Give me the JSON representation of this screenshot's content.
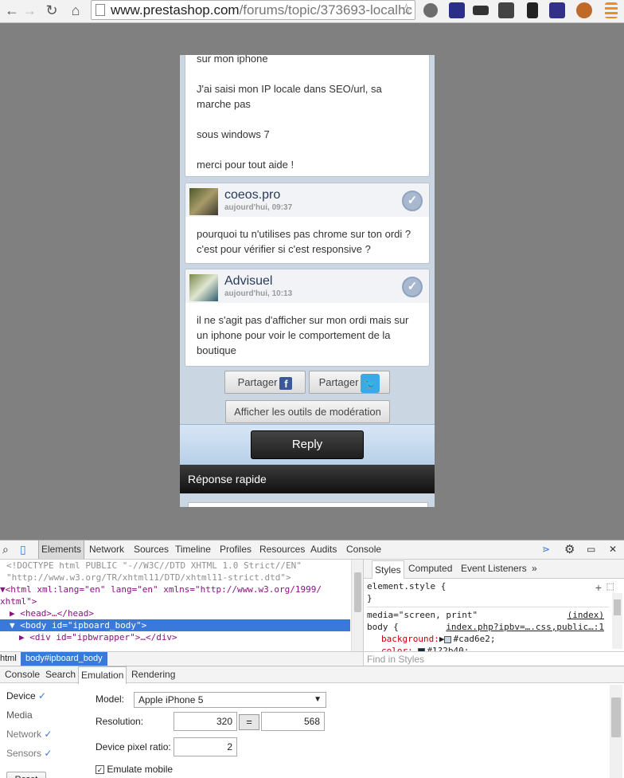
{
  "browser": {
    "url_host": "www.prestashop.com",
    "url_path": "/forums/topic/373693-localhc"
  },
  "page": {
    "first_post": {
      "lines": [
        "sur mon iphone",
        "J'ai saisi mon IP locale dans SEO/url, sa marche pas",
        "sous windows 7",
        "merci pour tout aide !"
      ]
    },
    "posts": [
      {
        "author": "coeos.pro",
        "date": "aujourd'hui, 09:37",
        "text": "pourquoi tu n'utilises pas chrome sur ton ordi ? c'est pour vérifier si c'est responsive ?"
      },
      {
        "author": "Advisuel",
        "date": "aujourd'hui, 10:13",
        "text": "il ne s'agit pas d'afficher sur mon ordi mais sur un iphone pour voir le comportement de la boutique"
      }
    ],
    "share_fb": "Partager",
    "share_tw": "Partager",
    "moderation": "Afficher les outils de modération",
    "reply": "Reply",
    "quick_reply": "Réponse rapide"
  },
  "devtools": {
    "tabs": [
      "Elements",
      "Network",
      "Sources",
      "Timeline",
      "Profiles",
      "Resources",
      "Audits",
      "Console"
    ],
    "code_lines": [
      "<!DOCTYPE html PUBLIC \"-//W3C//DTD XHTML 1.0 Strict//EN\"",
      "\"http://www.w3.org/TR/xhtml11/DTD/xhtml11-strict.dtd\">",
      "<html xml:lang=\"en\" lang=\"en\" xmlns=\"http://www.w3.org/1999/",
      "xhtml\">",
      "<head>…</head>",
      "<body id=\"ipboard_body\">",
      "<div id=\"ipbwrapper\">…</div>"
    ],
    "crumb_left": "html",
    "crumb_selected": "body#ipboard_body",
    "styles_tabs": [
      "Styles",
      "Computed",
      "Event Listeners",
      "»"
    ],
    "element_style": "element.style {",
    "close_brace": "}",
    "media": "media=\"screen, print\"",
    "media_link": "(index)",
    "body_rule": "body {",
    "body_link": "index.php?ipbv=….css,public…:1",
    "background_prop": "background:",
    "background_val": "#cad6e2;",
    "color_prop": "color:",
    "color_val": "#1?2b40;",
    "find_placeholder": "Find in Styles",
    "drawer_tabs": [
      "Console",
      "Search",
      "Emulation",
      "Rendering"
    ],
    "emu_side": [
      "Device",
      "Media",
      "Network",
      "Sensors"
    ],
    "model_label": "Model:",
    "model_value": "Apple iPhone 5",
    "resolution_label": "Resolution:",
    "res_width": "320",
    "res_height": "568",
    "swap_icon": "=",
    "dpr_label": "Device pixel ratio:",
    "dpr_value": "2",
    "emulate_mobile": "Emulate mobile",
    "reset": "Reset"
  }
}
